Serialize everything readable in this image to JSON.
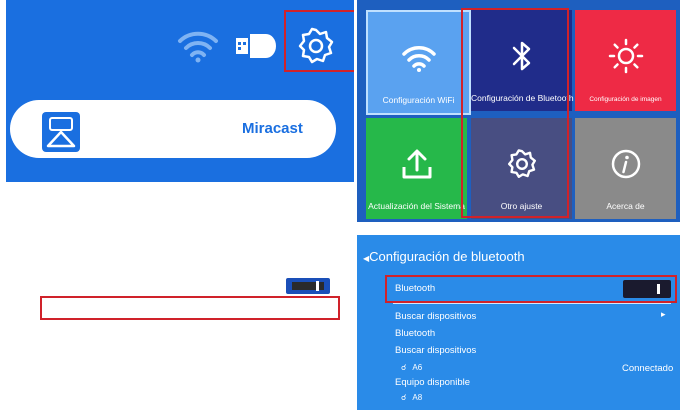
{
  "home": {
    "miracast_label": "Miracast",
    "icons": [
      "wifi-icon",
      "usb-icon",
      "gear-icon",
      "screen-mirror-icon"
    ]
  },
  "settings_grid": {
    "tiles": [
      {
        "label": "Configuración WiFi",
        "icon": "wifi-icon",
        "color": "#5aa2f0"
      },
      {
        "label": "Configuración de Bluetooth",
        "icon": "bluetooth-icon",
        "color": "#202c8a"
      },
      {
        "label": "Configuración de imagen",
        "icon": "brightness-icon",
        "color": "#ee2a45"
      },
      {
        "label": "Actualización del Sistema",
        "icon": "upload-icon",
        "color": "#26b84a"
      },
      {
        "label": "Otro ajuste",
        "icon": "gear-icon",
        "color": "#484e82"
      },
      {
        "label": "Acerca de",
        "icon": "info-icon",
        "color": "#8a8a8a"
      }
    ]
  },
  "bluetooth": {
    "title": "Configuración de bluetooth",
    "toggle_label": "Bluetooth",
    "search_label": "Buscar dispositivos",
    "section_label": "Bluetooth",
    "search_label_2": "Buscar dispositivos",
    "device_1": "A6",
    "device_1_status": "Connectado",
    "available_label": "Equipo disponible",
    "device_2": "A8"
  },
  "colors": {
    "highlight": "#d0222a",
    "home_bg": "#1a6fe0",
    "grid_bg": "#1e5fbf",
    "bt_bg": "#2a8be8"
  }
}
